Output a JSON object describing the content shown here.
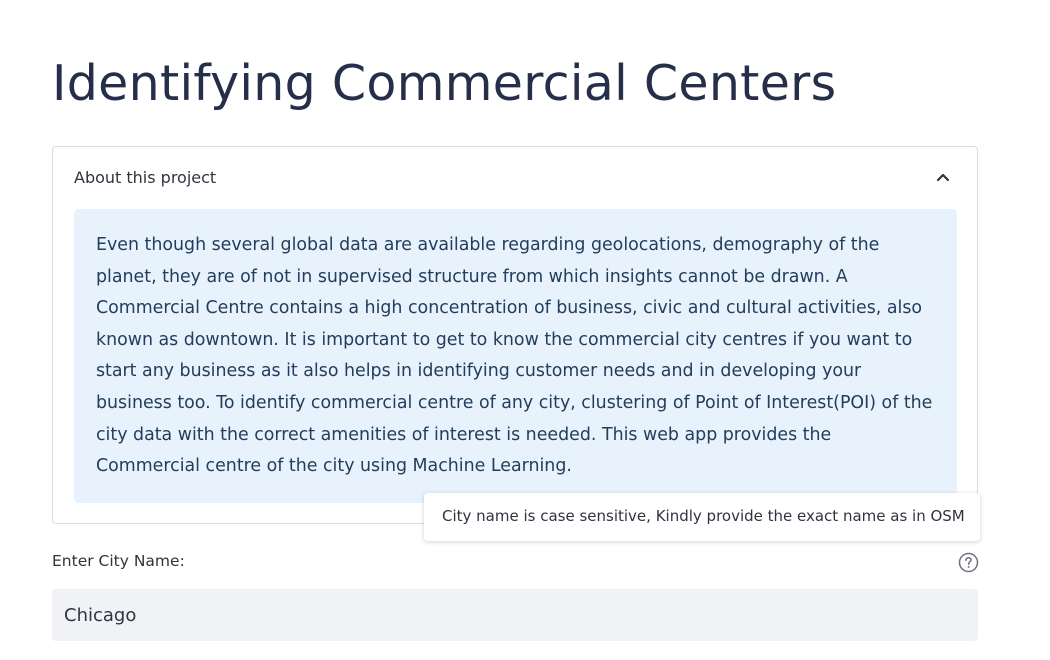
{
  "page": {
    "title": "Identifying Commercial Centers"
  },
  "expander": {
    "label": "About this project",
    "toggle_icon": "chevron-up-icon",
    "expanded": true,
    "description": "Even though several global data are available regarding geolocations, demography of the planet, they are of not in supervised structure from which insights cannot be drawn. A Commercial Centre contains a high concentration of business, civic and cultural activities, also known as downtown. It is important to get to know the commercial city centres if you want to start any business as it also helps in identifying customer needs and in developing your business too. To identify commercial centre of any city, clustering of Point of Interest(POI) of the city data with the correct amenities of interest is needed. This web app provides the Commercial centre of the city using Machine Learning."
  },
  "city_input": {
    "label": "Enter City Name:",
    "value": "Chicago",
    "help_icon": "question-circle-icon",
    "tooltip": "City name is case sensitive, Kindly provide the exact name as in OSM"
  },
  "colors": {
    "title": "#262f4a",
    "info_background": "#e8f2fd",
    "info_text": "#233d5c",
    "input_background": "#f0f2f6",
    "border": "#d6dbe4"
  }
}
